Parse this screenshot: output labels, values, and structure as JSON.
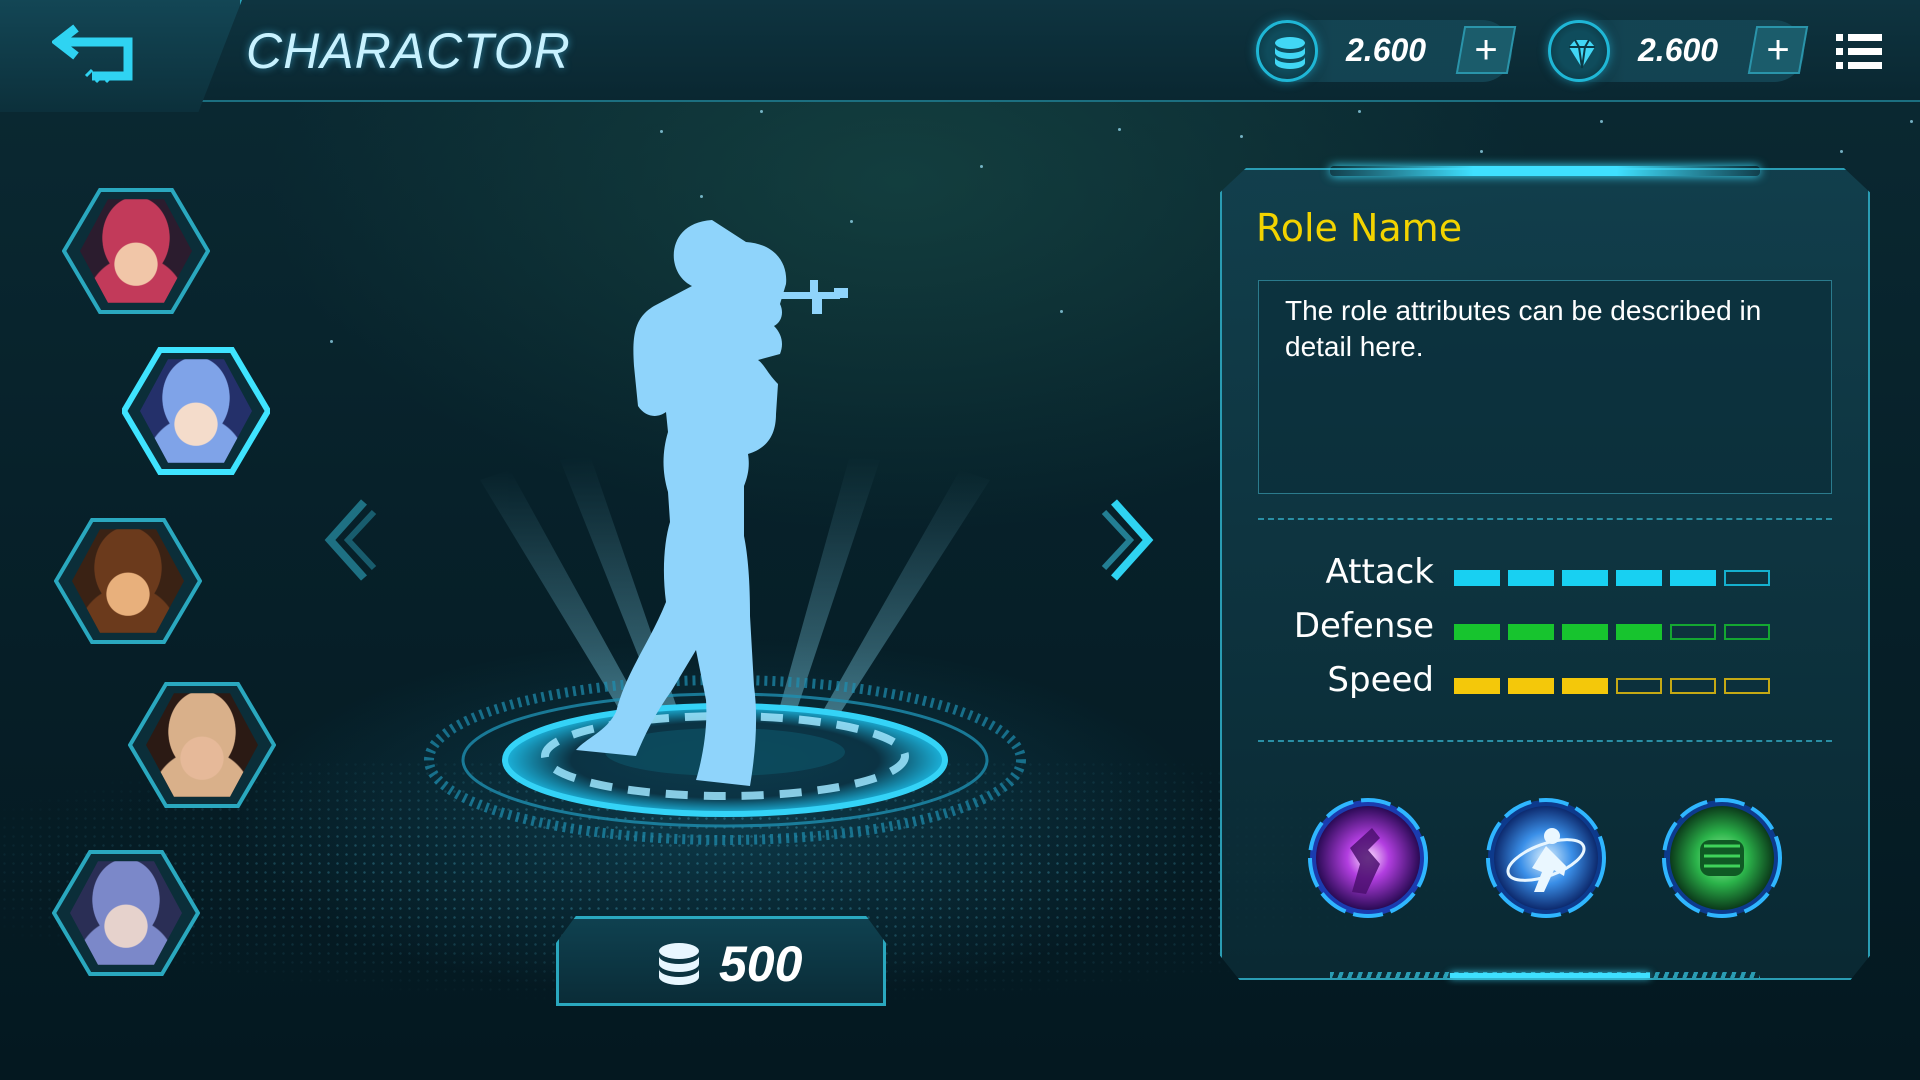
{
  "header": {
    "title": "CHARACTOR",
    "coins": "2.600",
    "gems": "2.600",
    "add_label": "+"
  },
  "characters": [
    {
      "name": "character-1",
      "hair": "#c23a5a",
      "skin": "#f1c6a8",
      "bg": "#2b1c2e"
    },
    {
      "name": "character-2",
      "hair": "#7fa3e8",
      "skin": "#f4dccb",
      "bg": "#24306a",
      "selected": true
    },
    {
      "name": "character-3",
      "hair": "#6b3a1c",
      "skin": "#e8b07c",
      "bg": "#3a2214"
    },
    {
      "name": "character-4",
      "hair": "#d9b08a",
      "skin": "#e6b999",
      "bg": "#2b1a14"
    },
    {
      "name": "character-5",
      "hair": "#7b88c9",
      "skin": "#e6d2cc",
      "bg": "#2a2e55"
    }
  ],
  "price": {
    "value": "500"
  },
  "role": {
    "name": "Role Name",
    "description": "The role attributes can be described in detail here.",
    "stats": [
      {
        "label": "Attack",
        "level": 5,
        "max": 6,
        "color": "#18d0f2"
      },
      {
        "label": "Defense",
        "level": 4,
        "max": 6,
        "color": "#17c42e"
      },
      {
        "label": "Speed",
        "level": 3,
        "max": 6,
        "color": "#f4c80a"
      }
    ]
  },
  "skills": [
    {
      "name": "shadow-strike-skill",
      "color": "#b23ee0"
    },
    {
      "name": "orbit-dash-skill",
      "color": "#3a8fe8"
    },
    {
      "name": "power-fist-skill",
      "color": "#2bb34a"
    }
  ],
  "colors": {
    "accent": "#2aa8bf",
    "title_glow": "#50d2ff",
    "role_name": "#f2d300"
  }
}
